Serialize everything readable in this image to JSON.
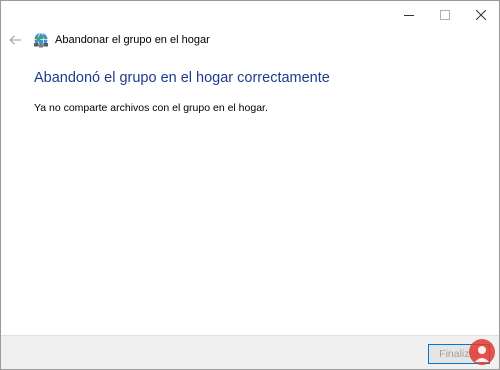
{
  "nav": {
    "title": "Abandonar el grupo en el hogar"
  },
  "content": {
    "heading": "Abandonó el grupo en el hogar correctamente",
    "message": "Ya no comparte archivos con el grupo en el hogar."
  },
  "footer": {
    "finish_label": "Finalizar"
  },
  "icons": {
    "back": "arrow-left-icon",
    "app": "homegroup-icon",
    "minimize": "minimize-icon",
    "maximize": "maximize-icon",
    "close": "close-icon"
  },
  "colors": {
    "heading": "#1e3c8c",
    "button_border": "#0078d7",
    "footer_bg": "#f0f0f0"
  }
}
